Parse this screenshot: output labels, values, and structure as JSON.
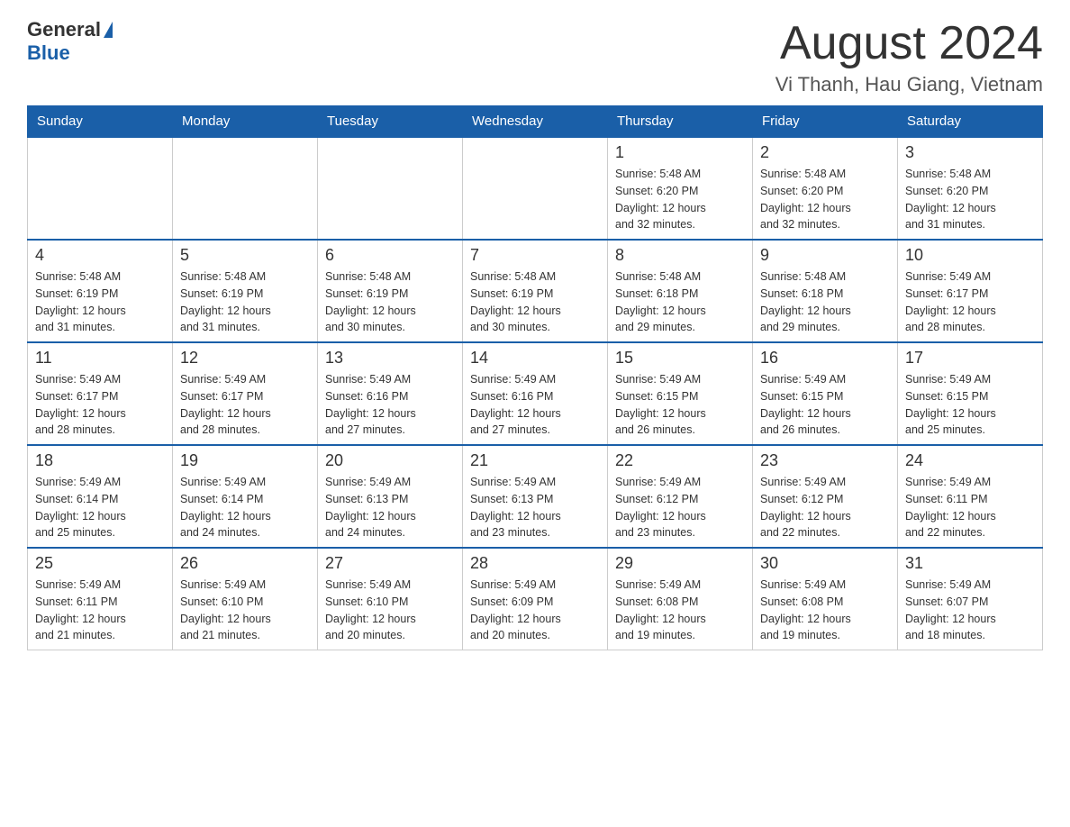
{
  "header": {
    "logo_general": "General",
    "logo_blue": "Blue",
    "title": "August 2024",
    "subtitle": "Vi Thanh, Hau Giang, Vietnam"
  },
  "days_of_week": [
    "Sunday",
    "Monday",
    "Tuesday",
    "Wednesday",
    "Thursday",
    "Friday",
    "Saturday"
  ],
  "weeks": [
    [
      {
        "day": "",
        "info": ""
      },
      {
        "day": "",
        "info": ""
      },
      {
        "day": "",
        "info": ""
      },
      {
        "day": "",
        "info": ""
      },
      {
        "day": "1",
        "info": "Sunrise: 5:48 AM\nSunset: 6:20 PM\nDaylight: 12 hours\nand 32 minutes."
      },
      {
        "day": "2",
        "info": "Sunrise: 5:48 AM\nSunset: 6:20 PM\nDaylight: 12 hours\nand 32 minutes."
      },
      {
        "day": "3",
        "info": "Sunrise: 5:48 AM\nSunset: 6:20 PM\nDaylight: 12 hours\nand 31 minutes."
      }
    ],
    [
      {
        "day": "4",
        "info": "Sunrise: 5:48 AM\nSunset: 6:19 PM\nDaylight: 12 hours\nand 31 minutes."
      },
      {
        "day": "5",
        "info": "Sunrise: 5:48 AM\nSunset: 6:19 PM\nDaylight: 12 hours\nand 31 minutes."
      },
      {
        "day": "6",
        "info": "Sunrise: 5:48 AM\nSunset: 6:19 PM\nDaylight: 12 hours\nand 30 minutes."
      },
      {
        "day": "7",
        "info": "Sunrise: 5:48 AM\nSunset: 6:19 PM\nDaylight: 12 hours\nand 30 minutes."
      },
      {
        "day": "8",
        "info": "Sunrise: 5:48 AM\nSunset: 6:18 PM\nDaylight: 12 hours\nand 29 minutes."
      },
      {
        "day": "9",
        "info": "Sunrise: 5:48 AM\nSunset: 6:18 PM\nDaylight: 12 hours\nand 29 minutes."
      },
      {
        "day": "10",
        "info": "Sunrise: 5:49 AM\nSunset: 6:17 PM\nDaylight: 12 hours\nand 28 minutes."
      }
    ],
    [
      {
        "day": "11",
        "info": "Sunrise: 5:49 AM\nSunset: 6:17 PM\nDaylight: 12 hours\nand 28 minutes."
      },
      {
        "day": "12",
        "info": "Sunrise: 5:49 AM\nSunset: 6:17 PM\nDaylight: 12 hours\nand 28 minutes."
      },
      {
        "day": "13",
        "info": "Sunrise: 5:49 AM\nSunset: 6:16 PM\nDaylight: 12 hours\nand 27 minutes."
      },
      {
        "day": "14",
        "info": "Sunrise: 5:49 AM\nSunset: 6:16 PM\nDaylight: 12 hours\nand 27 minutes."
      },
      {
        "day": "15",
        "info": "Sunrise: 5:49 AM\nSunset: 6:15 PM\nDaylight: 12 hours\nand 26 minutes."
      },
      {
        "day": "16",
        "info": "Sunrise: 5:49 AM\nSunset: 6:15 PM\nDaylight: 12 hours\nand 26 minutes."
      },
      {
        "day": "17",
        "info": "Sunrise: 5:49 AM\nSunset: 6:15 PM\nDaylight: 12 hours\nand 25 minutes."
      }
    ],
    [
      {
        "day": "18",
        "info": "Sunrise: 5:49 AM\nSunset: 6:14 PM\nDaylight: 12 hours\nand 25 minutes."
      },
      {
        "day": "19",
        "info": "Sunrise: 5:49 AM\nSunset: 6:14 PM\nDaylight: 12 hours\nand 24 minutes."
      },
      {
        "day": "20",
        "info": "Sunrise: 5:49 AM\nSunset: 6:13 PM\nDaylight: 12 hours\nand 24 minutes."
      },
      {
        "day": "21",
        "info": "Sunrise: 5:49 AM\nSunset: 6:13 PM\nDaylight: 12 hours\nand 23 minutes."
      },
      {
        "day": "22",
        "info": "Sunrise: 5:49 AM\nSunset: 6:12 PM\nDaylight: 12 hours\nand 23 minutes."
      },
      {
        "day": "23",
        "info": "Sunrise: 5:49 AM\nSunset: 6:12 PM\nDaylight: 12 hours\nand 22 minutes."
      },
      {
        "day": "24",
        "info": "Sunrise: 5:49 AM\nSunset: 6:11 PM\nDaylight: 12 hours\nand 22 minutes."
      }
    ],
    [
      {
        "day": "25",
        "info": "Sunrise: 5:49 AM\nSunset: 6:11 PM\nDaylight: 12 hours\nand 21 minutes."
      },
      {
        "day": "26",
        "info": "Sunrise: 5:49 AM\nSunset: 6:10 PM\nDaylight: 12 hours\nand 21 minutes."
      },
      {
        "day": "27",
        "info": "Sunrise: 5:49 AM\nSunset: 6:10 PM\nDaylight: 12 hours\nand 20 minutes."
      },
      {
        "day": "28",
        "info": "Sunrise: 5:49 AM\nSunset: 6:09 PM\nDaylight: 12 hours\nand 20 minutes."
      },
      {
        "day": "29",
        "info": "Sunrise: 5:49 AM\nSunset: 6:08 PM\nDaylight: 12 hours\nand 19 minutes."
      },
      {
        "day": "30",
        "info": "Sunrise: 5:49 AM\nSunset: 6:08 PM\nDaylight: 12 hours\nand 19 minutes."
      },
      {
        "day": "31",
        "info": "Sunrise: 5:49 AM\nSunset: 6:07 PM\nDaylight: 12 hours\nand 18 minutes."
      }
    ]
  ]
}
